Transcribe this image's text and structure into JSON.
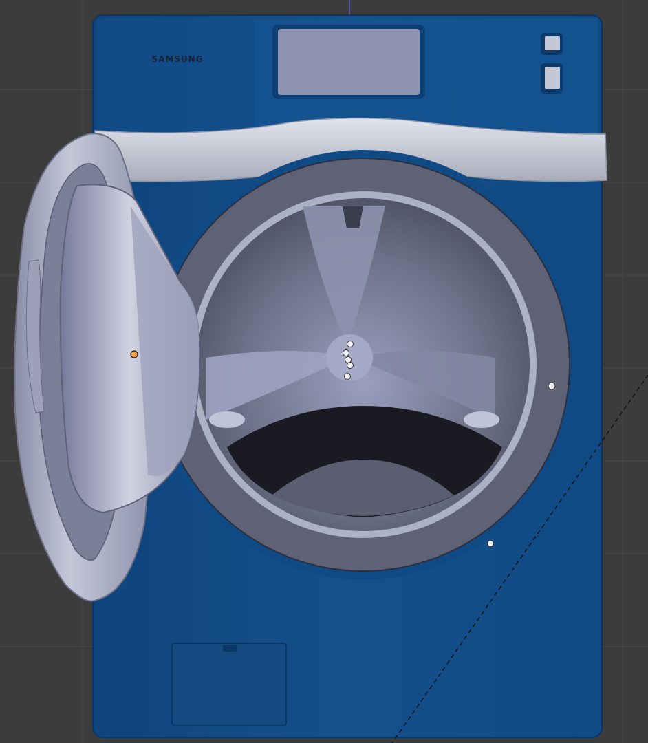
{
  "viewport": {
    "background": "#3c3c3c",
    "grid_color": "#474747",
    "axis_color": "#5a5a9a"
  },
  "washer": {
    "brand_label": "SAMSUNG",
    "body_color": "#15508c",
    "body_dark": "#0d3b6c",
    "trim_color": "#c8ccd6",
    "display_color": "#8e93b0",
    "drum_color": "#6e7389",
    "door_color": "#a9adc3"
  },
  "selection": {
    "active_color": "#f0a040",
    "vertex_color": "#f2f2f2",
    "dashed_line_color": "#111111"
  },
  "icons": [
    "orange-origin-point-icon",
    "white-vertex-point-icon",
    "button-square-icon"
  ]
}
